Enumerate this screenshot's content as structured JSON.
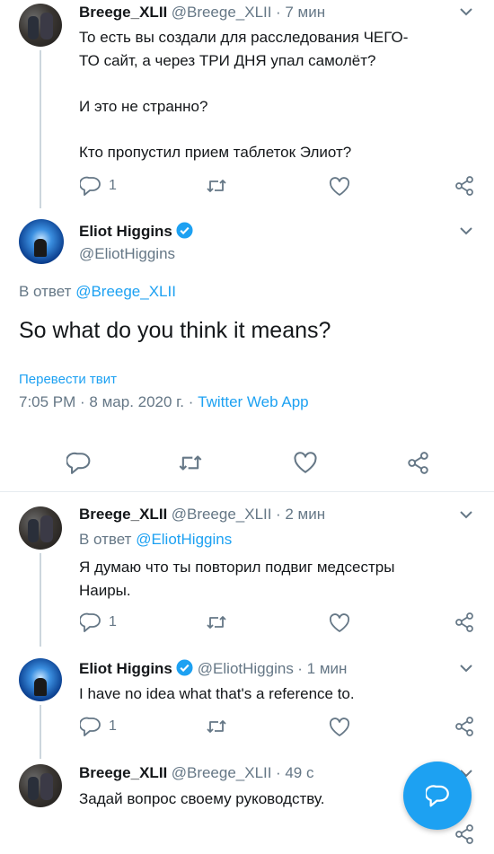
{
  "tweet1": {
    "name": "Breege_XLII",
    "handle": "@Breege_XLII",
    "time": "· 7 мин",
    "lines": [
      "То есть вы создали для расследования ЧЕГО-",
      "ТО сайт, а через ТРИ ДНЯ упал самолёт?",
      "И это не странно?",
      "Кто пропустил прием таблеток Элиот?"
    ],
    "reply_count": "1"
  },
  "main_tweet": {
    "name": "Eliot Higgins",
    "handle": "@EliotHiggins",
    "reply_prefix": "В ответ",
    "reply_to": "@Breege_XLII",
    "text": "So what do you think it means?",
    "translate": "Перевести твит",
    "timestamp": "7:05 PM · 8 мар. 2020 г. · ",
    "source": "Twitter Web App"
  },
  "tweet3": {
    "name": "Breege_XLII",
    "handle": "@Breege_XLII",
    "time": "· 2 мин",
    "reply_prefix": "В ответ",
    "reply_to": "@EliotHiggins",
    "lines": [
      "Я думаю что ты повторил подвиг медсестры",
      "Наиры."
    ],
    "reply_count": "1"
  },
  "tweet4": {
    "name": "Eliot Higgins",
    "handle": "@EliotHiggins",
    "time": "· 1 мин",
    "text": "I have no idea what that's a reference to.",
    "reply_count": "1"
  },
  "tweet5": {
    "name": "Breege_XLII",
    "handle": "@Breege_XLII",
    "time": "· 49 с",
    "text": "Задай вопрос своему руководству."
  },
  "colors": {
    "accent": "#1da1f2",
    "muted": "#657786",
    "line": "#ccd6dd"
  },
  "icons": [
    "reply-icon",
    "retweet-icon",
    "like-icon",
    "share-icon",
    "chevron-down-icon",
    "verified-icon",
    "compose-reply-icon"
  ]
}
